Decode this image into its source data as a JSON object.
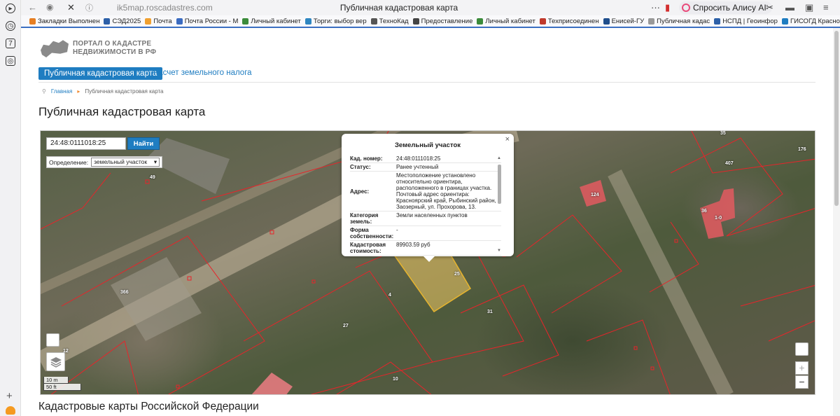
{
  "browser": {
    "url": "ik5map.roscadastres.com",
    "tab_title": "Публичная кадастровая карта",
    "ask_alice": "Спросить Алису AI",
    "bookmarks": [
      {
        "label": "Закладки Выполнен",
        "color": "#e67e22"
      },
      {
        "label": "СЭД2025",
        "color": "#2c5fa8"
      },
      {
        "label": "Почта",
        "color": "#f0a030"
      },
      {
        "label": "Почта России - М",
        "color": "#3a6bc1"
      },
      {
        "label": "Личный кабинет",
        "color": "#3b8b3b"
      },
      {
        "label": "Торги: выбор вер",
        "color": "#2e86c1"
      },
      {
        "label": "ТехноКад",
        "color": "#555555"
      },
      {
        "label": "Предоставление",
        "color": "#444444"
      },
      {
        "label": "Личный кабинет",
        "color": "#3b8b3b"
      },
      {
        "label": "Техприсоединен",
        "color": "#c0392b"
      },
      {
        "label": "Енисей-ГУ",
        "color": "#1f4e8c"
      },
      {
        "label": "Публичная кадас",
        "color": "#999999"
      },
      {
        "label": "НСПД | Геоинфор",
        "color": "#2c5fa8"
      },
      {
        "label": "ГИСОГД Красно",
        "color": "#1f7dc1"
      }
    ]
  },
  "site": {
    "logo_line1": "ПОРТАЛ О КАДАСТРЕ",
    "logo_line2": "НЕДВИЖИМОСТИ В РФ",
    "tab_active": "Публичная кадастровая карта",
    "tab_link": "Расчет земельного налога",
    "crumb_home": "Главная",
    "crumb_current": "Публичная кадастровая карта",
    "heading": "Публичная кадастровая карта",
    "footer_heading": "Кадастровые карты Российской Федерации"
  },
  "map": {
    "search_value": "24:48:0111018:25",
    "find_label": "Найти",
    "definition_label": "Определение:",
    "definition_value": "земельный участок",
    "scale_m": "10 m",
    "scale_ft": "50 ft",
    "zoom_in": "+",
    "zoom_out": "−",
    "parcel_labels": [
      "49",
      "366",
      "12",
      "27",
      "4",
      "25",
      "31",
      "10",
      "124",
      "36",
      "1-0",
      "407",
      "35",
      "176"
    ],
    "popup": {
      "title": "Земельный участок",
      "close": "×",
      "rows": [
        {
          "key": "Кад. номер:",
          "value": "24:48:0111018:25"
        },
        {
          "key": "Статус:",
          "value": "Ранее учтенный"
        },
        {
          "key": "Адрес:",
          "value": "Местоположение установлено относительно ориентира, расположенного в границах участка. Почтовый адрес ориентира: Красноярский край, Рыбинский район, г. Заозерный, ул. Прохорова, 13."
        },
        {
          "key": "Категория земель:",
          "value": "Земли населенных пунктов"
        },
        {
          "key": "Форма собственности:",
          "value": "-"
        },
        {
          "key": "Кадастровая стоимость:",
          "value": "89903.59 руб"
        }
      ]
    }
  }
}
